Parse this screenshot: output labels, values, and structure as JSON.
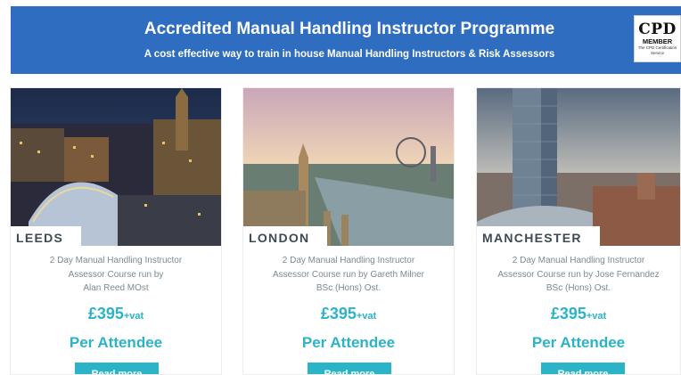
{
  "banner": {
    "title": "Accredited Manual Handling Instructor Programme",
    "subtitle": "A cost effective way to train in house Manual Handling Instructors & Risk Assessors",
    "badge": {
      "big": "CPD",
      "member": "MEMBER",
      "line": "The CPD Certification Service"
    }
  },
  "courses": [
    {
      "city": "LEEDS",
      "desc": [
        "2 Day Manual Handling Instructor",
        "Assessor Course run by",
        "Alan Reed MOst"
      ],
      "price": "£395",
      "vat": "+vat",
      "per": "Per Attendee",
      "button": "Read more"
    },
    {
      "city": "LONDON",
      "desc": [
        "2 Day Manual Handling Instructor",
        "Assessor Course run by Gareth Milner",
        "BSc (Hons) Ost."
      ],
      "price": "£395",
      "vat": "+vat",
      "per": "Per Attendee",
      "button": "Read more"
    },
    {
      "city": "MANCHESTER",
      "desc": [
        "2 Day Manual Handling Instructor",
        "Assessor Course run by Jose Fernandez",
        "BSc (Hons) Ost."
      ],
      "price": "£395",
      "vat": "+vat",
      "per": "Per Attendee",
      "button": "Read more"
    }
  ],
  "colors": {
    "banner": "#2f6dc0",
    "accent": "#2bb3c8",
    "label": "#3d4a54",
    "body_text": "#7b8a95"
  }
}
